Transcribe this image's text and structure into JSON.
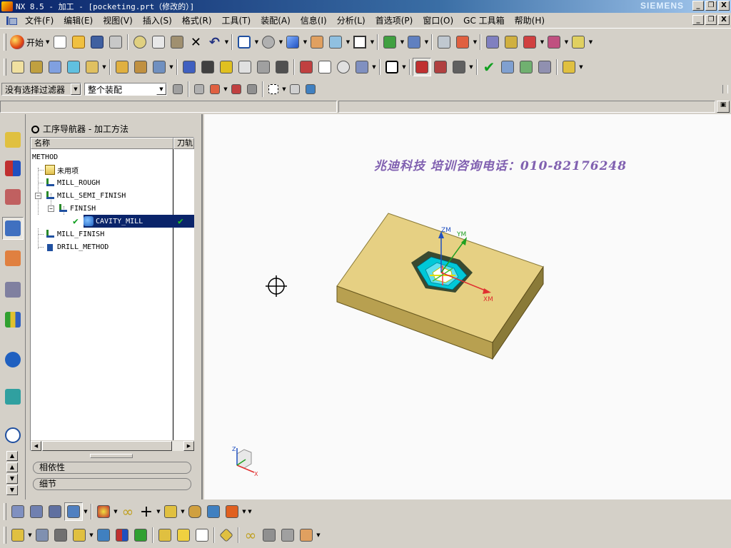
{
  "window": {
    "title": "NX 8.5 - 加工 - [pocketing.prt（修改的）]",
    "brand": "SIEMENS",
    "buttons": [
      "_",
      "❐",
      "X"
    ]
  },
  "menubar": {
    "items": [
      "文件(F)",
      "编辑(E)",
      "视图(V)",
      "插入(S)",
      "格式(R)",
      "工具(T)",
      "装配(A)",
      "信息(I)",
      "分析(L)",
      "首选项(P)",
      "窗口(O)",
      "GC 工具箱",
      "帮助(H)"
    ],
    "doc_buttons": [
      "_",
      "❐",
      "X"
    ]
  },
  "toolbar": {
    "start_label": "开始"
  },
  "filter": {
    "selection_filter": "没有选择过滤器",
    "scope": "整个装配"
  },
  "navigator": {
    "header": "工序导航器 - 加工方法",
    "columns": [
      "名称",
      "刀轨"
    ],
    "rows": [
      {
        "label": "METHOD",
        "icon": "none"
      },
      {
        "label": "未用项",
        "icon": "folder-icon"
      },
      {
        "label": "MILL_ROUGH",
        "icon": "method-icon"
      },
      {
        "label": "MILL_SEMI_FINISH",
        "icon": "method-icon"
      },
      {
        "label": "FINISH",
        "icon": "method-icon"
      },
      {
        "label": "CAVITY_MILL",
        "icon": "operation-icon",
        "status": "✔"
      },
      {
        "label": "MILL_FINISH",
        "icon": "method-icon"
      },
      {
        "label": "DRILL_METHOD",
        "icon": "drill-icon"
      }
    ],
    "dependencies": "相依性",
    "details": "细节"
  },
  "viewport": {
    "watermark": "兆迪科技 培训咨询电话：010-82176248",
    "axis_labels": {
      "zm": "ZM",
      "ym": "YM",
      "xm": "XM"
    },
    "triad_labels": {
      "z": "Z",
      "x": "X"
    },
    "colors": {
      "block_top": "#e6d083",
      "block_front": "#b8a050",
      "block_side": "#8a7a38",
      "pocket": "#00c8d8"
    }
  }
}
